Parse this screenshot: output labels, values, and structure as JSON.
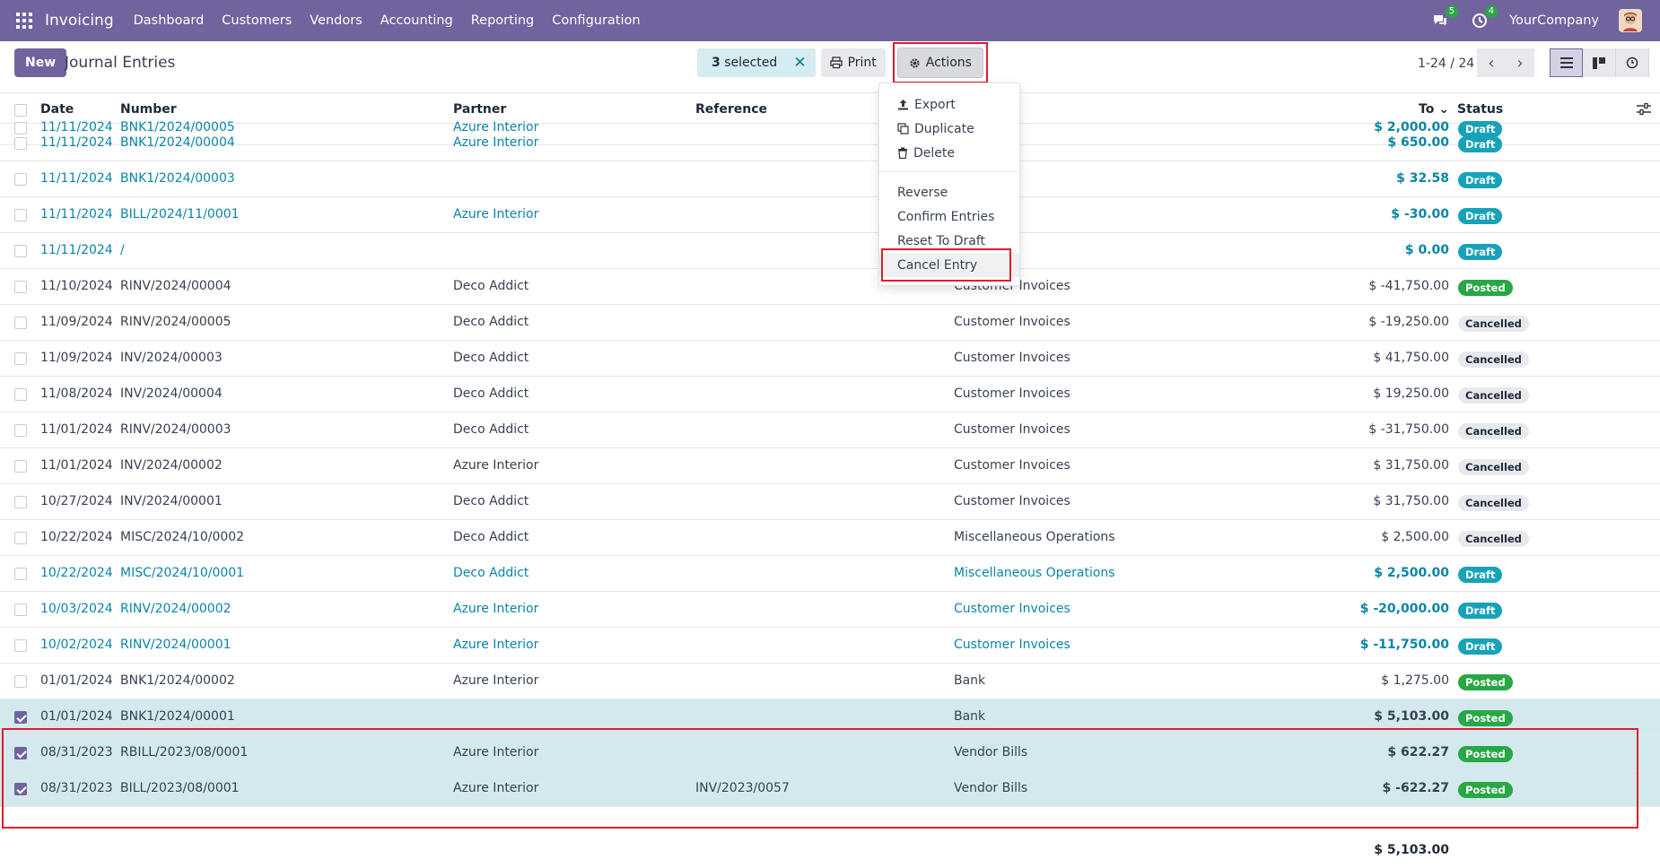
{
  "navbar": {
    "brand": "Invoicing",
    "menu": [
      "Dashboard",
      "Customers",
      "Vendors",
      "Accounting",
      "Reporting",
      "Configuration"
    ],
    "chat_count": "5",
    "activity_count": "4",
    "company": "YourCompany"
  },
  "control_panel": {
    "new_label": "New",
    "title": "Journal Entries",
    "selected_count": "3",
    "selected_suffix": "selected",
    "print_label": "Print",
    "actions_label": "Actions",
    "pager": "1-24 / 24"
  },
  "table": {
    "headers": {
      "date": "Date",
      "number": "Number",
      "partner": "Partner",
      "reference": "Reference",
      "total": "To",
      "status": "Status"
    },
    "rows": [
      {
        "date": "11/11/2024",
        "number": "BNK1/2024/00005",
        "partner": "Azure Interior",
        "reference": "",
        "journal": "",
        "amount": "$ 2,000.00",
        "status": "Draft",
        "draft": true,
        "selected": false
      },
      {
        "date": "11/11/2024",
        "number": "BNK1/2024/00004",
        "partner": "Azure Interior",
        "reference": "",
        "journal": "",
        "amount": "$ 650.00",
        "status": "Draft",
        "draft": true,
        "selected": false
      },
      {
        "date": "11/11/2024",
        "number": "BNK1/2024/00003",
        "partner": "",
        "reference": "",
        "journal": "",
        "amount": "$ 32.58",
        "status": "Draft",
        "draft": true,
        "selected": false
      },
      {
        "date": "11/11/2024",
        "number": "BILL/2024/11/0001",
        "partner": "Azure Interior",
        "reference": "",
        "journal": "",
        "amount": "$ -30.00",
        "status": "Draft",
        "draft": true,
        "selected": false
      },
      {
        "date": "11/11/2024",
        "number": "/",
        "partner": "",
        "reference": "",
        "journal": "",
        "amount": "$ 0.00",
        "status": "Draft",
        "draft": true,
        "selected": false
      },
      {
        "date": "11/10/2024",
        "number": "RINV/2024/00004",
        "partner": "Deco Addict",
        "reference": "",
        "journal": "Customer Invoices",
        "amount": "$ -41,750.00",
        "status": "Posted",
        "draft": false,
        "selected": false
      },
      {
        "date": "11/09/2024",
        "number": "RINV/2024/00005",
        "partner": "Deco Addict",
        "reference": "",
        "journal": "Customer Invoices",
        "amount": "$ -19,250.00",
        "status": "Cancelled",
        "draft": false,
        "selected": false
      },
      {
        "date": "11/09/2024",
        "number": "INV/2024/00003",
        "partner": "Deco Addict",
        "reference": "",
        "journal": "Customer Invoices",
        "amount": "$ 41,750.00",
        "status": "Cancelled",
        "draft": false,
        "selected": false
      },
      {
        "date": "11/08/2024",
        "number": "INV/2024/00004",
        "partner": "Deco Addict",
        "reference": "",
        "journal": "Customer Invoices",
        "amount": "$ 19,250.00",
        "status": "Cancelled",
        "draft": false,
        "selected": false
      },
      {
        "date": "11/01/2024",
        "number": "RINV/2024/00003",
        "partner": "Deco Addict",
        "reference": "",
        "journal": "Customer Invoices",
        "amount": "$ -31,750.00",
        "status": "Cancelled",
        "draft": false,
        "selected": false
      },
      {
        "date": "11/01/2024",
        "number": "INV/2024/00002",
        "partner": "Azure Interior",
        "reference": "",
        "journal": "Customer Invoices",
        "amount": "$ 31,750.00",
        "status": "Cancelled",
        "draft": false,
        "selected": false
      },
      {
        "date": "10/27/2024",
        "number": "INV/2024/00001",
        "partner": "Deco Addict",
        "reference": "",
        "journal": "Customer Invoices",
        "amount": "$ 31,750.00",
        "status": "Cancelled",
        "draft": false,
        "selected": false
      },
      {
        "date": "10/22/2024",
        "number": "MISC/2024/10/0002",
        "partner": "Deco Addict",
        "reference": "",
        "journal": "Miscellaneous Operations",
        "amount": "$ 2,500.00",
        "status": "Cancelled",
        "draft": false,
        "selected": false
      },
      {
        "date": "10/22/2024",
        "number": "MISC/2024/10/0001",
        "partner": "Deco Addict",
        "reference": "",
        "journal": "Miscellaneous Operations",
        "amount": "$ 2,500.00",
        "status": "Draft",
        "draft": true,
        "selected": false
      },
      {
        "date": "10/03/2024",
        "number": "RINV/2024/00002",
        "partner": "Azure Interior",
        "reference": "",
        "journal": "Customer Invoices",
        "amount": "$ -20,000.00",
        "status": "Draft",
        "draft": true,
        "selected": false
      },
      {
        "date": "10/02/2024",
        "number": "RINV/2024/00001",
        "partner": "Azure Interior",
        "reference": "",
        "journal": "Customer Invoices",
        "amount": "$ -11,750.00",
        "status": "Draft",
        "draft": true,
        "selected": false
      },
      {
        "date": "01/01/2024",
        "number": "BNK1/2024/00002",
        "partner": "Azure Interior",
        "reference": "",
        "journal": "Bank",
        "amount": "$ 1,275.00",
        "status": "Posted",
        "draft": false,
        "selected": false
      },
      {
        "date": "01/01/2024",
        "number": "BNK1/2024/00001",
        "partner": "",
        "reference": "",
        "journal": "Bank",
        "amount": "$ 5,103.00",
        "status": "Posted",
        "draft": false,
        "selected": true
      },
      {
        "date": "08/31/2023",
        "number": "RBILL/2023/08/0001",
        "partner": "Azure Interior",
        "reference": "",
        "journal": "Vendor Bills",
        "amount": "$ 622.27",
        "status": "Posted",
        "draft": false,
        "selected": true
      },
      {
        "date": "08/31/2023",
        "number": "BILL/2023/08/0001",
        "partner": "Azure Interior",
        "reference": "INV/2023/0057",
        "journal": "Vendor Bills",
        "amount": "$ -622.27",
        "status": "Posted",
        "draft": false,
        "selected": true
      }
    ],
    "total": "$ 5,103.00"
  },
  "actions_menu": {
    "group1": [
      {
        "label": "Export",
        "icon": "upload-icon"
      },
      {
        "label": "Duplicate",
        "icon": "copy-icon"
      },
      {
        "label": "Delete",
        "icon": "trash-icon"
      }
    ],
    "group2": [
      "Reverse",
      "Confirm Entries",
      "Reset To Draft",
      "Cancel Entry"
    ]
  },
  "colors": {
    "brand": "#71639e",
    "link": "#0b85a6",
    "draft": "#17a2b8",
    "posted": "#28a745",
    "highlight": "#e11d2b"
  }
}
